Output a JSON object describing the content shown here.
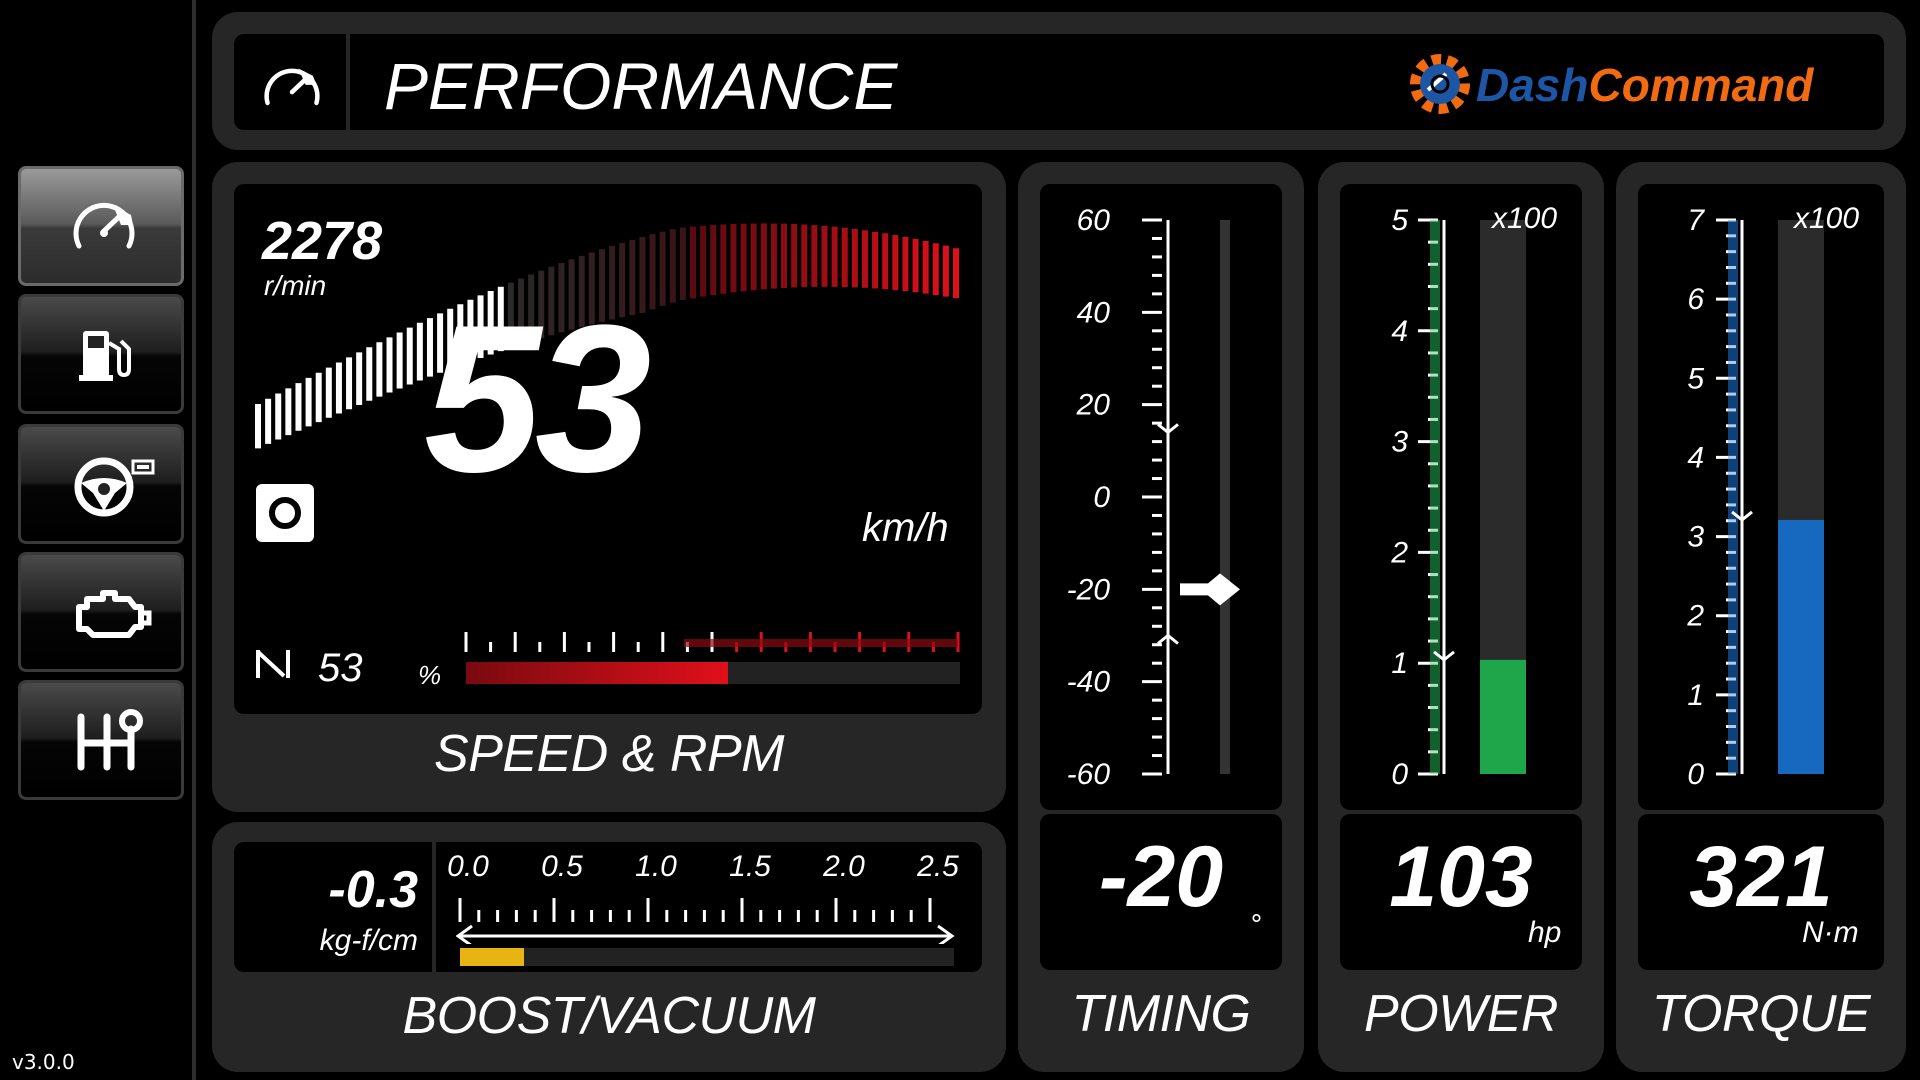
{
  "app": {
    "version": "v3.0.0"
  },
  "header": {
    "title": "PERFORMANCE",
    "brand_part1": "Dash",
    "brand_part2": "Command"
  },
  "sidebar": {
    "items": [
      {
        "name": "performance",
        "icon": "speedometer-icon",
        "active": true
      },
      {
        "name": "fuel",
        "icon": "fuel-pump-icon",
        "active": false
      },
      {
        "name": "driving",
        "icon": "steering-wheel-icon",
        "active": false
      },
      {
        "name": "engine",
        "icon": "check-engine-icon",
        "active": false
      },
      {
        "name": "gearbox",
        "icon": "gear-shift-icon",
        "active": false
      }
    ]
  },
  "speed_rpm": {
    "label": "SPEED & RPM",
    "rpm_value": "2278",
    "rpm_unit": "r/min",
    "rpm_fraction": 0.35,
    "speed_value": "53",
    "speed_unit": "km/h",
    "throttle_value": "53",
    "throttle_unit": "%",
    "throttle_fraction": 0.53
  },
  "boost": {
    "label": "BOOST/VACUUM",
    "value": "-0.3",
    "unit": "kg-f/cm",
    "scale": [
      "0.0",
      "0.5",
      "1.0",
      "1.5",
      "2.0",
      "2.5"
    ],
    "bar_fraction": 0.13
  },
  "timing": {
    "label": "TIMING",
    "value": "-20",
    "unit": "°",
    "scale": [
      "60",
      "40",
      "20",
      "0",
      "-20",
      "-40",
      "-60"
    ],
    "current": -20,
    "max_marker": 14,
    "min_marker": -30
  },
  "power": {
    "label": "POWER",
    "value": "103",
    "unit": "hp",
    "multiplier": "x100",
    "scale": [
      "5",
      "4",
      "3",
      "2",
      "1",
      "0"
    ],
    "current": 1.03,
    "max": 5
  },
  "torque": {
    "label": "TORQUE",
    "value": "321",
    "unit": "N·m",
    "multiplier": "x100",
    "scale": [
      "7",
      "6",
      "5",
      "4",
      "3",
      "2",
      "1",
      "0"
    ],
    "current": 3.21,
    "max": 7
  },
  "colors": {
    "accent_red": "#e0101a",
    "power_green": "#1fa64a",
    "torque_blue": "#1769bf",
    "boost_yellow": "#e8b414",
    "brand_blue": "#1e56a6",
    "brand_orange": "#f26b10"
  }
}
